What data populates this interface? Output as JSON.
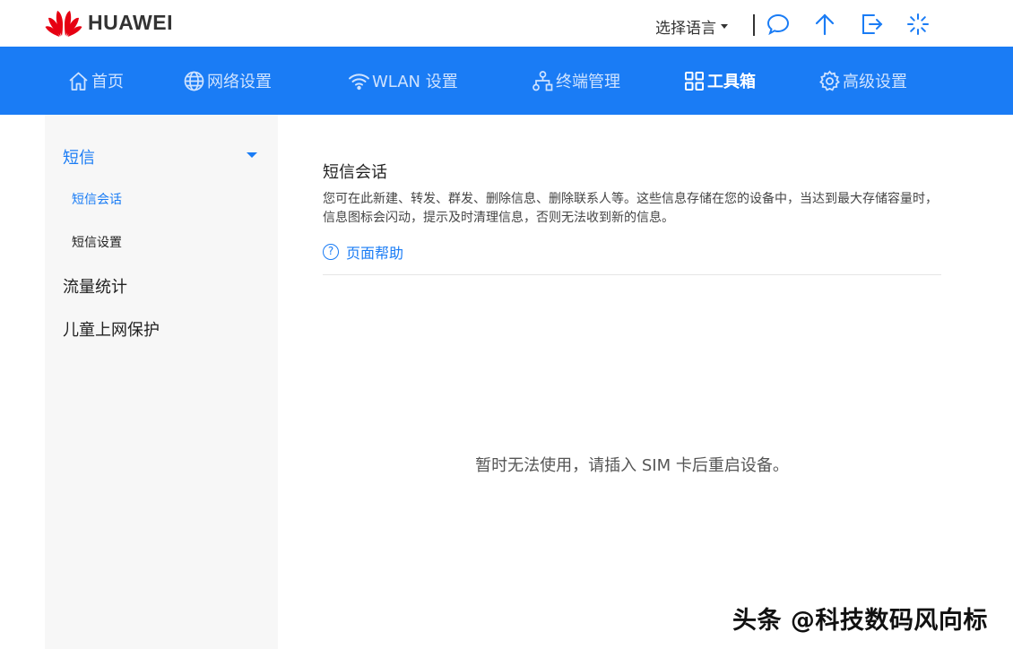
{
  "header": {
    "brand": "HUAWEI",
    "language_label": "选择语言",
    "icons": [
      "chat-icon",
      "upload-icon",
      "logout-icon",
      "loading-icon"
    ]
  },
  "nav": {
    "items": [
      {
        "label": "首页",
        "icon": "home-icon"
      },
      {
        "label": "网络设置",
        "icon": "globe-icon"
      },
      {
        "label": "WLAN 设置",
        "icon": "wifi-icon"
      },
      {
        "label": "终端管理",
        "icon": "devices-icon"
      },
      {
        "label": "工具箱",
        "icon": "toolbox-icon",
        "active": true
      },
      {
        "label": "高级设置",
        "icon": "gear-icon"
      }
    ],
    "active_color": "#ffffff",
    "bar_color": "#1a7cf5"
  },
  "sidebar": {
    "groups": [
      {
        "label": "短信",
        "expanded": true,
        "children": [
          {
            "label": "短信会话",
            "active": true
          },
          {
            "label": "短信设置"
          }
        ]
      },
      {
        "label": "流量统计"
      },
      {
        "label": "儿童上网保护"
      }
    ]
  },
  "main": {
    "title": "短信会话",
    "desc_line1": "您可在此新建、转发、群发、删除信息、删除联系人等。这些信息存储在您的设备中，当达到最大存储容量时，",
    "desc_line2": "信息图标会闪动，提示及时清理信息，否则无法收到新的信息。",
    "help_icon": "?",
    "help_label": "页面帮助",
    "notice": "暂时无法使用，请插入 SIM 卡后重启设备。"
  },
  "watermark": "头条 @科技数码风向标",
  "colors": {
    "accent": "#1a7cf5"
  }
}
